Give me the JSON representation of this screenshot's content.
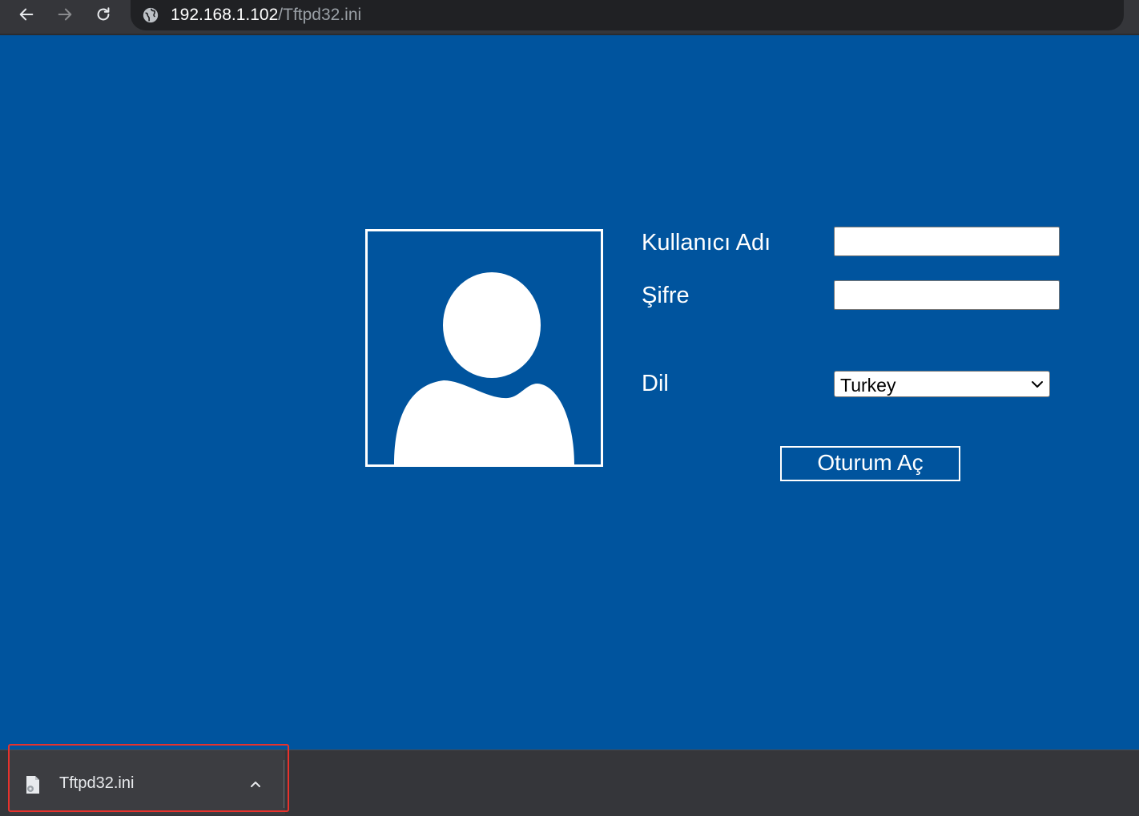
{
  "browser": {
    "url_host": "192.168.1.102",
    "url_path": "/Tftpd32.ini",
    "icons": {
      "back": "arrow-left-icon",
      "forward": "arrow-right-icon",
      "reload": "reload-icon",
      "site_info": "globe-icon"
    }
  },
  "login": {
    "username_label": "Kullanıcı Adı",
    "username_value": "",
    "password_label": "Şifre",
    "password_value": "",
    "language_label": "Dil",
    "language_selected": "Turkey",
    "submit_label": "Oturum Aç",
    "avatar_icon": "user-avatar-icon"
  },
  "downloads": {
    "items": [
      {
        "filename": "Tftpd32.ini",
        "icon": "file-icon",
        "menu_icon": "chevron-up-icon"
      }
    ],
    "highlight_color": "#e8322c"
  },
  "colors": {
    "page_background": "#00549e",
    "chrome_background": "#35363a",
    "omnibox_background": "#202124"
  }
}
